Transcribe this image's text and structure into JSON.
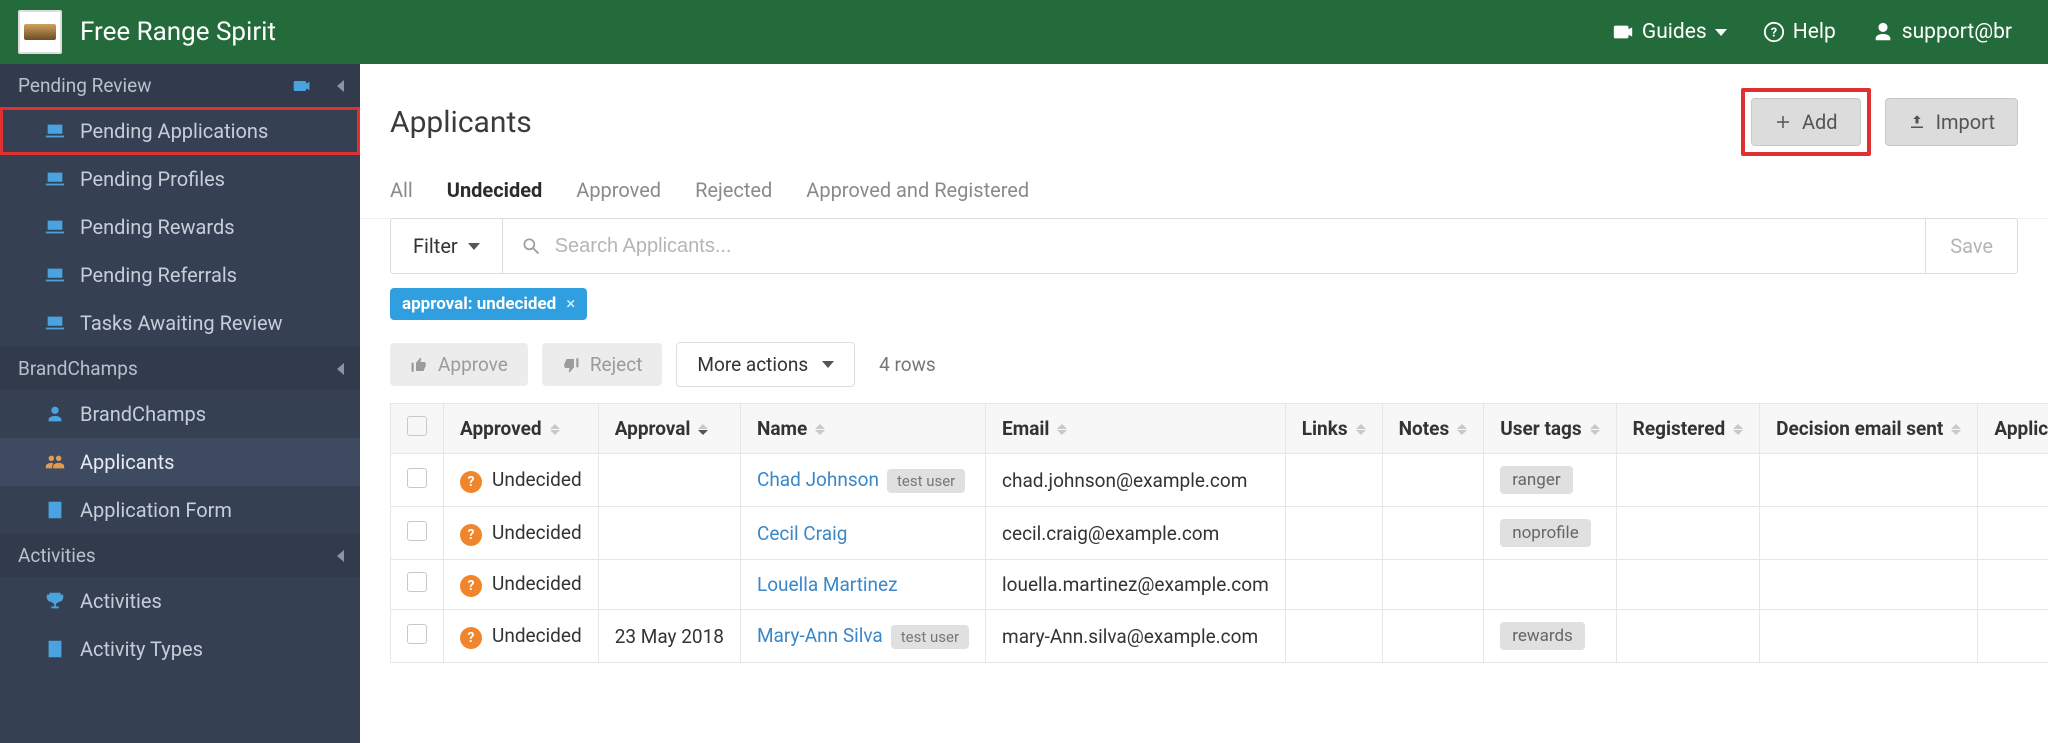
{
  "header": {
    "brand": "Free Range Spirit",
    "guides": "Guides",
    "help": "Help",
    "user": "support@br"
  },
  "sidebar": {
    "groups": [
      {
        "label": "Pending Review",
        "has_camera": true,
        "items": [
          {
            "label": "Pending Applications",
            "icon": "laptop",
            "highlighted": true
          },
          {
            "label": "Pending Profiles",
            "icon": "laptop"
          },
          {
            "label": "Pending Rewards",
            "icon": "laptop"
          },
          {
            "label": "Pending Referrals",
            "icon": "laptop"
          },
          {
            "label": "Tasks Awaiting Review",
            "icon": "laptop"
          }
        ]
      },
      {
        "label": "BrandChamps",
        "items": [
          {
            "label": "BrandChamps",
            "icon": "person"
          },
          {
            "label": "Applicants",
            "icon": "people",
            "active": true
          },
          {
            "label": "Application Form",
            "icon": "form"
          }
        ]
      },
      {
        "label": "Activities",
        "items": [
          {
            "label": "Activities",
            "icon": "trophy"
          },
          {
            "label": "Activity Types",
            "icon": "form"
          }
        ]
      }
    ]
  },
  "page": {
    "title": "Applicants",
    "add_label": "Add",
    "import_label": "Import"
  },
  "tabs": [
    {
      "label": "All"
    },
    {
      "label": "Undecided",
      "active": true
    },
    {
      "label": "Approved"
    },
    {
      "label": "Rejected"
    },
    {
      "label": "Approved and Registered"
    }
  ],
  "filter": {
    "label": "Filter",
    "placeholder": "Search Applicants...",
    "save_label": "Save",
    "chip": "approval: undecided"
  },
  "actions": {
    "approve": "Approve",
    "reject": "Reject",
    "more": "More actions",
    "rowcount": "4 rows"
  },
  "table": {
    "columns": [
      "Approved",
      "Approval",
      "Name",
      "Email",
      "Links",
      "Notes",
      "User tags",
      "Registered",
      "Decision email sent",
      "Application"
    ],
    "rows": [
      {
        "approved": "Undecided",
        "approval": "",
        "name": "Chad Johnson",
        "name_pill": "test user",
        "email": "chad.johnson@example.com",
        "links": "",
        "notes": "",
        "tags": [
          "ranger"
        ],
        "registered": "",
        "decision": "",
        "application": ""
      },
      {
        "approved": "Undecided",
        "approval": "",
        "name": "Cecil Craig",
        "name_pill": "",
        "email": "cecil.craig@example.com",
        "links": "",
        "notes": "",
        "tags": [
          "noprofile"
        ],
        "registered": "",
        "decision": "",
        "application": ""
      },
      {
        "approved": "Undecided",
        "approval": "",
        "name": "Louella Martinez",
        "name_pill": "",
        "email": "louella.martinez@example.com",
        "links": "",
        "notes": "",
        "tags": [],
        "registered": "",
        "decision": "",
        "application": ""
      },
      {
        "approved": "Undecided",
        "approval": "23 May 2018",
        "name": "Mary-Ann Silva",
        "name_pill": "test user",
        "email": "mary-Ann.silva@example.com",
        "links": "",
        "notes": "",
        "tags": [
          "rewards"
        ],
        "registered": "",
        "decision": "",
        "application": ""
      }
    ]
  }
}
